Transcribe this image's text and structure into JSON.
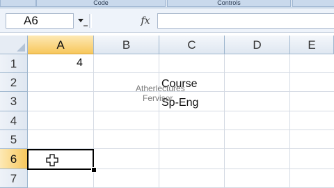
{
  "ribbon": {
    "groups": [
      {
        "label": ""
      },
      {
        "label": "Code"
      },
      {
        "label": "Controls"
      },
      {
        "label": ""
      }
    ]
  },
  "formula_bar": {
    "name_box": "A6",
    "fx_icon": "fx-icon",
    "formula": ""
  },
  "columns": [
    "A",
    "B",
    "C",
    "D",
    "E"
  ],
  "selected_column": "A",
  "rows": [
    "1",
    "2",
    "3",
    "4",
    "5",
    "6",
    "7"
  ],
  "selected_row": "6",
  "cells": {
    "A1": "4",
    "C2": "Course",
    "C3": "Sp-Eng"
  },
  "watermark": {
    "line1": "Atherlectures",
    "line2": "Fervisor"
  },
  "icons": {
    "cursor": "plus-cross-cursor-icon",
    "corner": "select-all-icon",
    "dropdown": "chevron-down-icon"
  }
}
